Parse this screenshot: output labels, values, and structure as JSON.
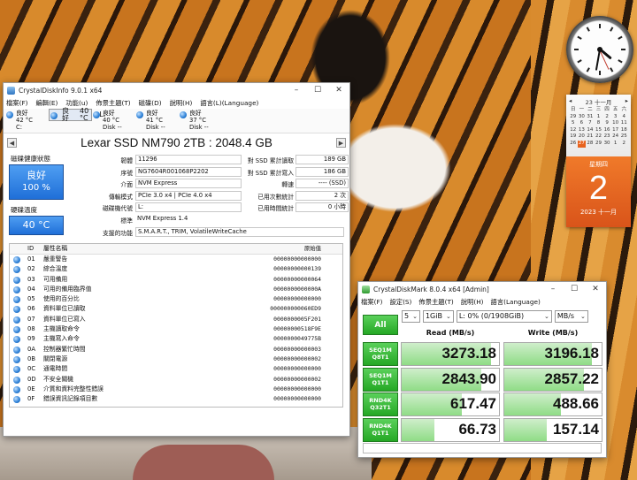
{
  "desktop": {
    "calendar": {
      "header": "23 十一月",
      "weekdays": [
        "日",
        "一",
        "二",
        "三",
        "四",
        "五",
        "六"
      ],
      "days": [
        "29",
        "30",
        "31",
        "1",
        "2",
        "3",
        "4",
        "5",
        "6",
        "7",
        "8",
        "9",
        "10",
        "11",
        "12",
        "13",
        "14",
        "15",
        "16",
        "17",
        "18",
        "19",
        "20",
        "21",
        "22",
        "23",
        "24",
        "25",
        "26",
        "27",
        "28",
        "29",
        "30",
        "1",
        "2"
      ],
      "today_index": 5,
      "weekday": "星期四",
      "day": "2",
      "year_month": "2023 十一月"
    }
  },
  "cdi": {
    "title": "CrystalDiskInfo 9.0.1 x64",
    "menu": [
      "檔案(F)",
      "編輯(E)",
      "功能(u)",
      "佈景主題(T)",
      "磁碟(D)",
      "說明(H)",
      "語言(L)(Language)"
    ],
    "drives": [
      {
        "status": "良好",
        "temp": "42 °C",
        "name": "C:"
      },
      {
        "status": "良好",
        "temp": "40 °C",
        "name": "L:"
      },
      {
        "status": "良好",
        "temp": "40 °C",
        "name": "Disk --"
      },
      {
        "status": "良好",
        "temp": "41 °C",
        "name": "Disk --"
      },
      {
        "status": "良好",
        "temp": "37 °C",
        "name": "Disk --"
      }
    ],
    "model": "Lexar SSD NM790 2TB : 2048.4 GB",
    "health_label": "磁碟健康狀態",
    "health_status": "良好",
    "health_pct": "100 %",
    "temp_label": "硬碟溫度",
    "temp_value": "40 °C",
    "info": [
      {
        "k": "韌體",
        "v": "11296"
      },
      {
        "k": "序號",
        "v": "NG7604R001068P2202"
      },
      {
        "k": "介面",
        "v": "NVM Express"
      },
      {
        "k": "傳輸模式",
        "v": "PCIe 3.0 x4 | PCIe 4.0 x4"
      },
      {
        "k": "磁碟機代號",
        "v": "L:"
      },
      {
        "k": "標準",
        "v": "NVM Express 1.4"
      }
    ],
    "features_key": "支援的功能",
    "features_val": "S.M.A.R.T., TRIM, VolatileWriteCache",
    "right": [
      {
        "k": "對 SSD 累計讀取",
        "v": "189 GB"
      },
      {
        "k": "對 SSD 累計寫入",
        "v": "186 GB"
      },
      {
        "k": "轉速",
        "v": "---- (SSD)"
      },
      {
        "k": "已用次數統計",
        "v": "2 次"
      },
      {
        "k": "已用時間統計",
        "v": "0 小時"
      }
    ],
    "smart_headers": {
      "id": "ID",
      "name": "屬性名稱",
      "raw": "原始值"
    },
    "smart": [
      {
        "id": "01",
        "name": "嚴重警告",
        "raw": "00000000000000"
      },
      {
        "id": "02",
        "name": "綜合溫度",
        "raw": "00000000000139"
      },
      {
        "id": "03",
        "name": "可用備用",
        "raw": "00000000000064"
      },
      {
        "id": "04",
        "name": "可用的備用臨界值",
        "raw": "0000000000000A"
      },
      {
        "id": "05",
        "name": "使用的百分比",
        "raw": "00000000000000"
      },
      {
        "id": "06",
        "name": "資料單位已讀取",
        "raw": "000000000060ED9"
      },
      {
        "id": "07",
        "name": "資料單位已寫入",
        "raw": "0000000005F201"
      },
      {
        "id": "08",
        "name": "主機讀取命令",
        "raw": "00000000518F9E"
      },
      {
        "id": "09",
        "name": "主機寫入命令",
        "raw": "0000000049775B"
      },
      {
        "id": "0A",
        "name": "控制器繁忙時間",
        "raw": "00000000000003"
      },
      {
        "id": "0B",
        "name": "關閉電源",
        "raw": "00000000000002"
      },
      {
        "id": "0C",
        "name": "通電時間",
        "raw": "00000000000000"
      },
      {
        "id": "0D",
        "name": "不安全關機",
        "raw": "00000000000002"
      },
      {
        "id": "0E",
        "name": "介質和資料完整性錯誤",
        "raw": "00000000000000"
      },
      {
        "id": "0F",
        "name": "錯誤資訊記錄項目數",
        "raw": "00000000000000"
      }
    ]
  },
  "cdm": {
    "title": "CrystalDiskMark 8.0.4 x64 [Admin]",
    "menu": [
      "檔案(F)",
      "設定(S)",
      "佈景主題(T)",
      "說明(H)",
      "語言(Language)"
    ],
    "all_label": "All",
    "count": "5",
    "size": "1GiB",
    "drive": "L: 0% (0/1908GiB)",
    "unit": "MB/s",
    "read_header": "Read (MB/s)",
    "write_header": "Write (MB/s)",
    "rows": [
      {
        "l1": "SEQ1M",
        "l2": "Q8T1",
        "read": "3273.18",
        "write": "3196.18",
        "rf": 0.92,
        "wf": 0.9
      },
      {
        "l1": "SEQ1M",
        "l2": "Q1T1",
        "read": "2843.90",
        "write": "2857.22",
        "rf": 0.82,
        "wf": 0.82
      },
      {
        "l1": "RND4K",
        "l2": "Q32T1",
        "read": "617.47",
        "write": "488.66",
        "rf": 0.62,
        "wf": 0.58
      },
      {
        "l1": "RND4K",
        "l2": "Q1T1",
        "read": "66.73",
        "write": "157.14",
        "rf": 0.34,
        "wf": 0.44
      }
    ]
  }
}
